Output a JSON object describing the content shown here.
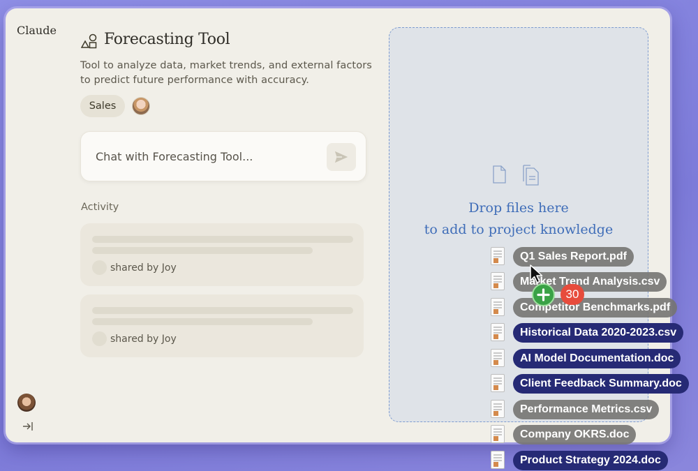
{
  "app": {
    "brand": "Claude"
  },
  "project": {
    "icon": "shapes-icon",
    "title": "Forecasting Tool",
    "description": "Tool to analyze data, market trends, and external factors to predict future performance with accuracy.",
    "tag": "Sales"
  },
  "chat": {
    "placeholder": "Chat with Forecasting Tool...",
    "send_icon": "send-icon"
  },
  "activity": {
    "label": "Activity",
    "items": [
      {
        "shared_by": "shared by Joy"
      },
      {
        "shared_by": "shared by Joy"
      }
    ]
  },
  "sidebar": {
    "toggle_icon": "expand-sidebar-icon"
  },
  "dropzone": {
    "icons": [
      "file-icon",
      "files-icon"
    ],
    "line1": "Drop files here",
    "line2": "to add to project knowledge",
    "border_color": "#7d9bd0",
    "text_color": "#3f6db8"
  },
  "drag": {
    "count": "30",
    "add_icon": "plus-icon",
    "files": [
      {
        "name": "Q1 Sales Report.pdf",
        "style": "gray"
      },
      {
        "name": "Market Trend Analysis.csv",
        "style": "gray"
      },
      {
        "name": "Competitor Benchmarks.pdf",
        "style": "gray"
      },
      {
        "name": "Historical Data 2020-2023.csv",
        "style": "navy"
      },
      {
        "name": "AI Model Documentation.doc",
        "style": "navy"
      },
      {
        "name": "Client Feedback Summary.doc",
        "style": "navy"
      },
      {
        "name": "Performance Metrics.csv",
        "style": "gray"
      },
      {
        "name": "Company OKRS.doc",
        "style": "gray"
      },
      {
        "name": "Product Strategy 2024.doc",
        "style": "navy"
      }
    ]
  },
  "colors": {
    "background": "#8f8fe6",
    "window": "#f1efe8",
    "pill_navy": "#262a75",
    "pill_gray": "#767472",
    "badge_red": "#e74c3c",
    "badge_green": "#3aa246"
  }
}
